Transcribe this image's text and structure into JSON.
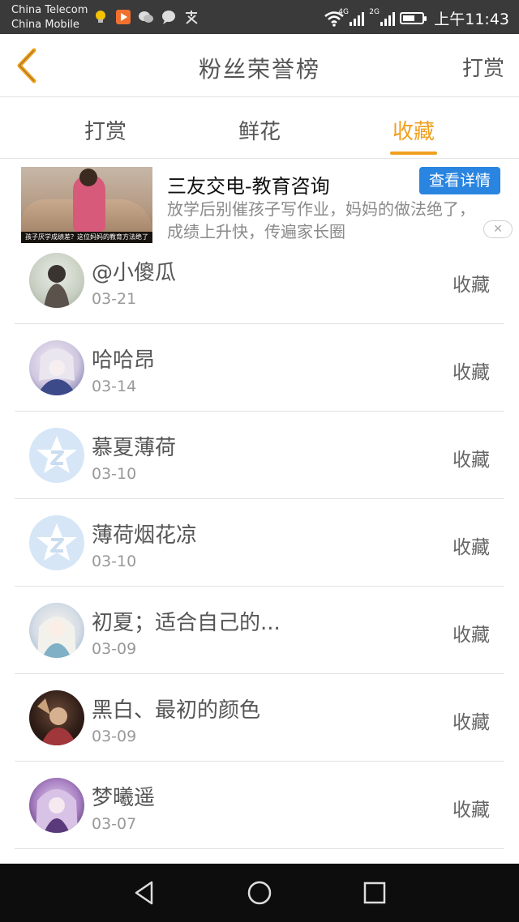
{
  "status_bar": {
    "carrier_1": "China Telecom",
    "carrier_2": "China Mobile",
    "network_1": "4G",
    "network_2": "2G",
    "time": "上午11:43"
  },
  "header": {
    "title": "粉丝荣誉榜",
    "right_action": "打赏"
  },
  "tabs": [
    {
      "label": "打赏",
      "active": false
    },
    {
      "label": "鲜花",
      "active": false
    },
    {
      "label": "收藏",
      "active": true
    }
  ],
  "ad": {
    "title": "三友交电-教育咨询",
    "button": "查看详情",
    "description": "放学后别催孩子写作业，妈妈的做法绝了，成绩上升快，传遍家长圈",
    "image_caption": "孩子厌学成绩差？这位妈妈的教育方法绝了"
  },
  "fans": [
    {
      "name": "@小傻瓜",
      "date": "03-21",
      "action": "收藏"
    },
    {
      "name": "哈哈昂",
      "date": "03-14",
      "action": "收藏"
    },
    {
      "name": "慕夏薄荷",
      "date": "03-10",
      "action": "收藏"
    },
    {
      "name": "薄荷烟花凉",
      "date": "03-10",
      "action": "收藏"
    },
    {
      "name": "初夏；适合自己的...",
      "date": "03-09",
      "action": "收藏"
    },
    {
      "name": "黑白、最初的颜色",
      "date": "03-09",
      "action": "收藏"
    },
    {
      "name": "梦曦遥",
      "date": "03-07",
      "action": "收藏"
    }
  ],
  "colors": {
    "accent": "#f0a020",
    "ad_button": "#2a85e0",
    "status_bar": "#3a3a3a",
    "nav_bar": "#0d0d0d"
  }
}
